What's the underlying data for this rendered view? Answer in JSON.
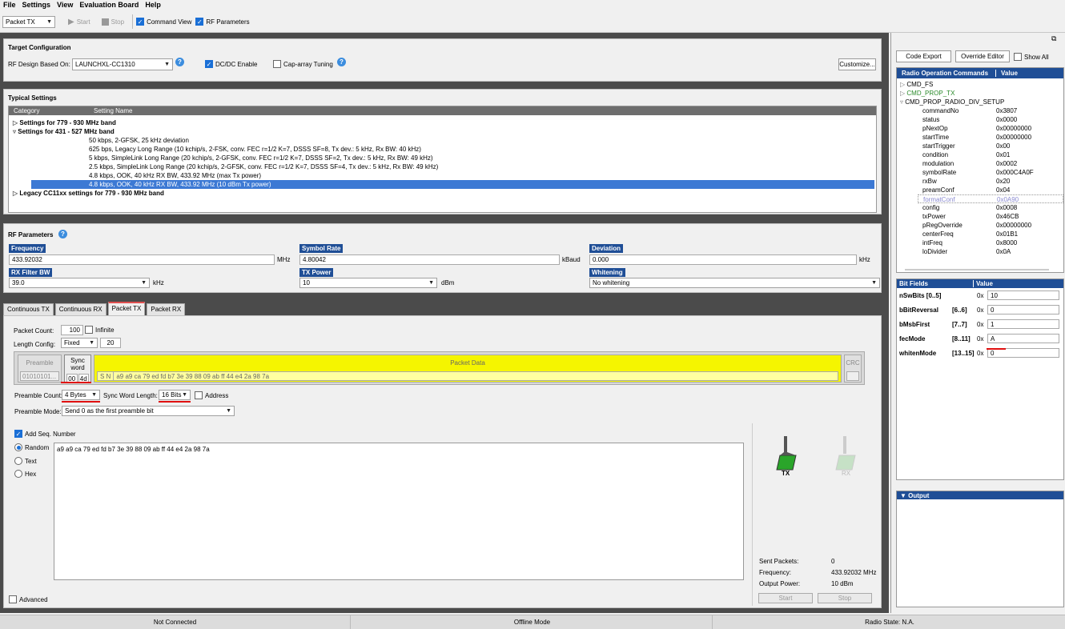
{
  "menu": [
    "File",
    "Settings",
    "View",
    "Evaluation Board",
    "Help"
  ],
  "toolbar": {
    "mode": "Packet TX",
    "start": "Start",
    "stop": "Stop",
    "command_view": "Command View",
    "rf_parameters": "RF Parameters"
  },
  "target": {
    "title": "Target Configuration",
    "design_label": "RF Design Based On:",
    "design_value": "LAUNCHXL-CC1310",
    "dcdc": "DC/DC Enable",
    "caparray": "Cap-array Tuning",
    "customize": "Customize..."
  },
  "typical": {
    "title": "Typical Settings",
    "col_category": "Category",
    "col_setting": "Setting Name",
    "groups": [
      "Settings for 779 - 930 MHz band",
      "Settings for 431 - 527 MHz band",
      "Legacy CC11xx settings for 779 - 930 MHz band"
    ],
    "items": [
      "50 kbps, 2-GFSK, 25 kHz deviation",
      "625 bps, Legacy Long Range (10 kchip/s, 2-FSK, conv. FEC r=1/2 K=7, DSSS SF=8, Tx dev.: 5 kHz, Rx BW: 40 kHz)",
      "5 kbps, SimpleLink Long Range (20 kchip/s, 2-GFSK, conv. FEC r=1/2 K=7, DSSS SF=2, Tx dev.: 5 kHz, Rx BW: 49 kHz)",
      "2.5 kbps, SimpleLink Long Range (20 kchip/s, 2-GFSK, conv. FEC r=1/2 K=7, DSSS SF=4, Tx dev.: 5 kHz, Rx BW: 49 kHz)",
      "4.8 kbps, OOK, 40 kHz RX BW, 433.92 MHz (max Tx power)",
      "4.8 kbps, OOK, 40 kHz RX BW, 433.92 MHz (10 dBm Tx power)"
    ]
  },
  "rfparams": {
    "title": "RF Parameters",
    "frequency_label": "Frequency",
    "frequency": "433.92032",
    "frequency_unit": "MHz",
    "symbol_label": "Symbol Rate",
    "symbol": "4.80042",
    "symbol_unit": "kBaud",
    "deviation_label": "Deviation",
    "deviation": "0.000",
    "deviation_unit": "kHz",
    "rxbw_label": "RX Filter BW",
    "rxbw": "39.0",
    "rxbw_unit": "kHz",
    "txpower_label": "TX Power",
    "txpower": "10",
    "txpower_unit": "dBm",
    "whitening_label": "Whitening",
    "whitening": "No whitening"
  },
  "tabs": [
    "Continuous TX",
    "Continuous RX",
    "Packet TX",
    "Packet RX"
  ],
  "packet": {
    "count_label": "Packet Count:",
    "count": "100",
    "infinite": "Infinite",
    "length_label": "Length Config:",
    "length_mode": "Fixed",
    "length": "20",
    "preamble": "Preamble",
    "preamble_val": "01010101...",
    "sync_word": "Sync word",
    "sync1": "00",
    "sync2": "4d",
    "packet_data": "Packet Data",
    "sn": "S N",
    "data_hex": "a9 a9 ca 79 ed fd b7 3e 39 88 09 ab ff 44 e4 2a 98 7a",
    "crc": "CRC",
    "preamble_count_label": "Preamble Count:",
    "preamble_count": "4 Bytes",
    "sync_len_label": "Sync Word Length:",
    "sync_len": "16 Bits",
    "address": "Address",
    "preamble_mode_label": "Preamble Mode:",
    "preamble_mode": "Send 0 as the first preamble bit",
    "add_seq": "Add Seq. Number",
    "random": "Random",
    "text": "Text",
    "hex": "Hex",
    "payload": "a9 a9 ca 79 ed fd b7 3e 39 88 09 ab ff 44 e4 2a 98 7a",
    "advanced": "Advanced"
  },
  "status_panel": {
    "tx": "TX",
    "rx": "RX",
    "sent_label": "Sent Packets:",
    "sent": "0",
    "freq_label": "Frequency:",
    "freq": "433.92032 MHz",
    "power_label": "Output Power:",
    "power": "10 dBm",
    "start": "Start",
    "stop": "Stop"
  },
  "right": {
    "code_export": "Code Export",
    "override_editor": "Override Editor",
    "show_all": "Show All",
    "col_cmd": "Radio Operation Commands",
    "col_val": "Value",
    "cmds": [
      "CMD_FS",
      "CMD_PROP_TX",
      "CMD_PROP_RADIO_DIV_SETUP"
    ],
    "fields": [
      {
        "n": "commandNo",
        "v": "0x3807"
      },
      {
        "n": "status",
        "v": "0x0000"
      },
      {
        "n": "pNextOp",
        "v": "0x00000000"
      },
      {
        "n": "startTime",
        "v": "0x00000000"
      },
      {
        "n": "startTrigger",
        "v": "0x00"
      },
      {
        "n": "condition",
        "v": "0x01"
      },
      {
        "n": "modulation",
        "v": "0x0002"
      },
      {
        "n": "symbolRate",
        "v": "0x000C4A0F"
      },
      {
        "n": "rxBw",
        "v": "0x20"
      },
      {
        "n": "preamConf",
        "v": "0x04"
      },
      {
        "n": "formatConf",
        "v": "0x0A90"
      },
      {
        "n": "config",
        "v": "0x0008"
      },
      {
        "n": "txPower",
        "v": "0x46CB"
      },
      {
        "n": "pRegOverride",
        "v": "0x00000000"
      },
      {
        "n": "centerFreq",
        "v": "0x01B1"
      },
      {
        "n": "intFreq",
        "v": "0x8000"
      },
      {
        "n": "loDivider",
        "v": "0x0A"
      }
    ],
    "bit_col": "Bit Fields",
    "bit_val": "Value",
    "bits": [
      {
        "n": "nSwBits [0..5]",
        "r": "",
        "p": "0x",
        "v": "10"
      },
      {
        "n": "bBitReversal",
        "r": "[6..6]",
        "p": "0x",
        "v": "0"
      },
      {
        "n": "bMsbFirst",
        "r": "[7..7]",
        "p": "0x",
        "v": "1"
      },
      {
        "n": "fecMode",
        "r": "[8..11]",
        "p": "0x",
        "v": "A"
      },
      {
        "n": "whitenMode",
        "r": "[13..15]",
        "p": "0x",
        "v": "0"
      }
    ],
    "output": "Output"
  },
  "status": {
    "conn": "Not Connected",
    "mode": "Offline Mode",
    "radio": "Radio State: N.A."
  }
}
